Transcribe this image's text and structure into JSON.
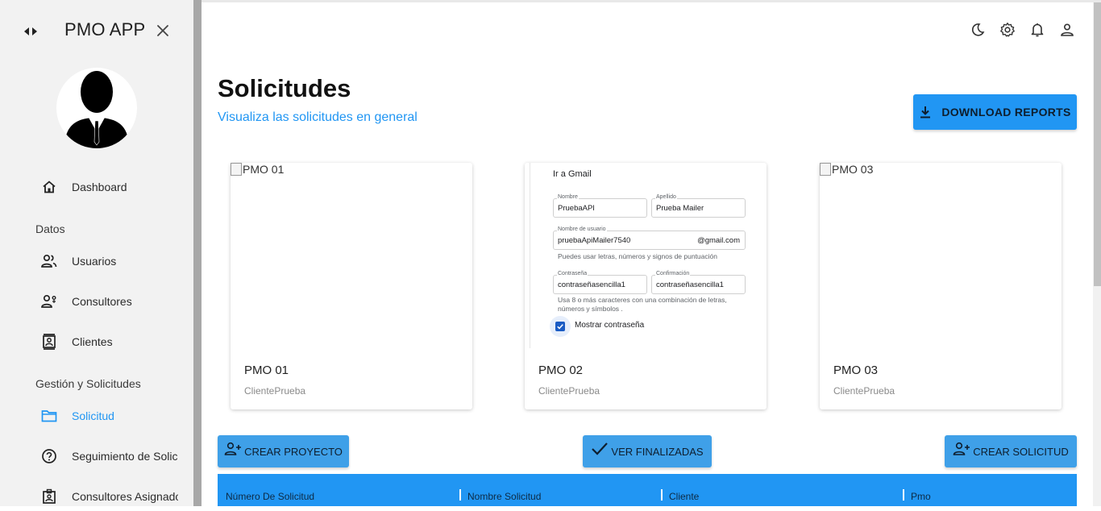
{
  "app": {
    "title": "PMO APP"
  },
  "sidebar": {
    "toggle_icon": "collapse-toggle-icon",
    "close_icon": "close-icon",
    "sections": {
      "datos": "Datos",
      "gestion": "Gestión y Solicitudes"
    },
    "items": [
      {
        "label": "Dashboard",
        "icon": "home-icon"
      },
      {
        "label": "Usuarios",
        "icon": "users-icon"
      },
      {
        "label": "Consultores",
        "icon": "consultant-icon"
      },
      {
        "label": "Clientes",
        "icon": "contact-card-icon"
      },
      {
        "label": "Solicitud",
        "icon": "folder-icon",
        "active": true
      },
      {
        "label": "Seguimiento de Solicitudes",
        "icon": "help-circle-icon"
      },
      {
        "label": "Consultores Asignados",
        "icon": "assigned-badge-icon"
      }
    ]
  },
  "topbar": {
    "icons": [
      "dark-mode-icon",
      "settings-icon",
      "notifications-icon",
      "account-icon"
    ]
  },
  "header": {
    "title": "Solicitudes",
    "subtitle": "Visualiza las solicitudes en general",
    "download_label": "DOWNLOAD REPORTS"
  },
  "cards": [
    {
      "alt": "PMO 01",
      "name": "PMO 01",
      "client": "ClientePrueba"
    },
    {
      "alt": "",
      "name": "PMO 02",
      "client": "ClientePrueba"
    },
    {
      "alt": "PMO 03",
      "name": "PMO 03",
      "client": "ClientePrueba"
    }
  ],
  "gmail": {
    "title": "Ir a Gmail",
    "nombre_label": "Nombre",
    "nombre": "PruebaAPI",
    "apellido_label": "Apellido",
    "apellido": "Prueba Mailer",
    "usuario_label": "Nombre de usuario",
    "usuario": "pruebaApiMailer7540",
    "suffix": "@gmail.com",
    "usuario_hint": "Puedes usar letras, números y signos de puntuación",
    "pass_label": "Contraseña",
    "pass": "contraseñasencilla1",
    "confirm_label": "Confirmación",
    "confirm": "contraseñasencilla1",
    "pass_hint": "Usa 8 o más caracteres con una combinación de letras, números y símbolos .",
    "show_password": "Mostrar contraseña",
    "show_password_checked": true
  },
  "actions": {
    "crear_proyecto": "CREAR PROYECTO",
    "ver_finalizadas": "VER FINALIZADAS",
    "crear_solicitud": "CREAR SOLICITUD"
  },
  "table": {
    "columns": [
      "Número De Solicitud",
      "Nombre Solicitud",
      "Cliente",
      "Pmo"
    ]
  },
  "colors": {
    "accent": "#2196f3",
    "sidebar_bg": "#f2f2f2",
    "divider": "#a8a8a8"
  }
}
